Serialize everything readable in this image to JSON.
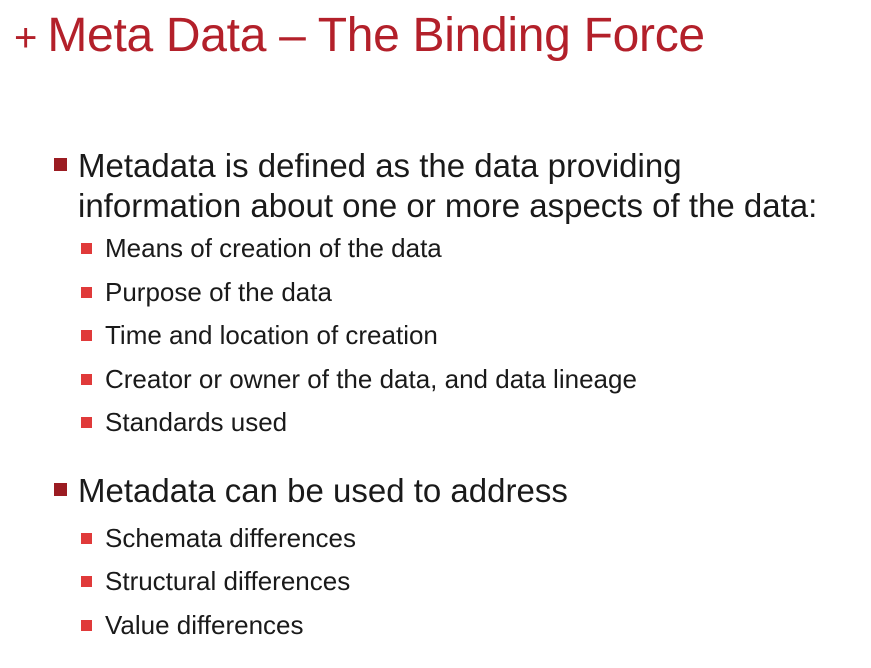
{
  "slide": {
    "title_prefix": "+",
    "title": "Meta Data – The Binding Force",
    "accent_color": "#b3202a",
    "bullets": [
      {
        "text_line1": "Metadata is defined as the data providing",
        "text_line2": "information about one or more aspects of the data:",
        "sub": [
          "Means of creation of the data",
          "Purpose of the data",
          "Time and location of creation",
          "Creator or owner of the data, and data lineage",
          "Standards used"
        ]
      },
      {
        "text_line1": "Metadata can be used to address",
        "sub": [
          "Schemata differences",
          "Structural differences",
          "Value differences"
        ]
      }
    ]
  }
}
